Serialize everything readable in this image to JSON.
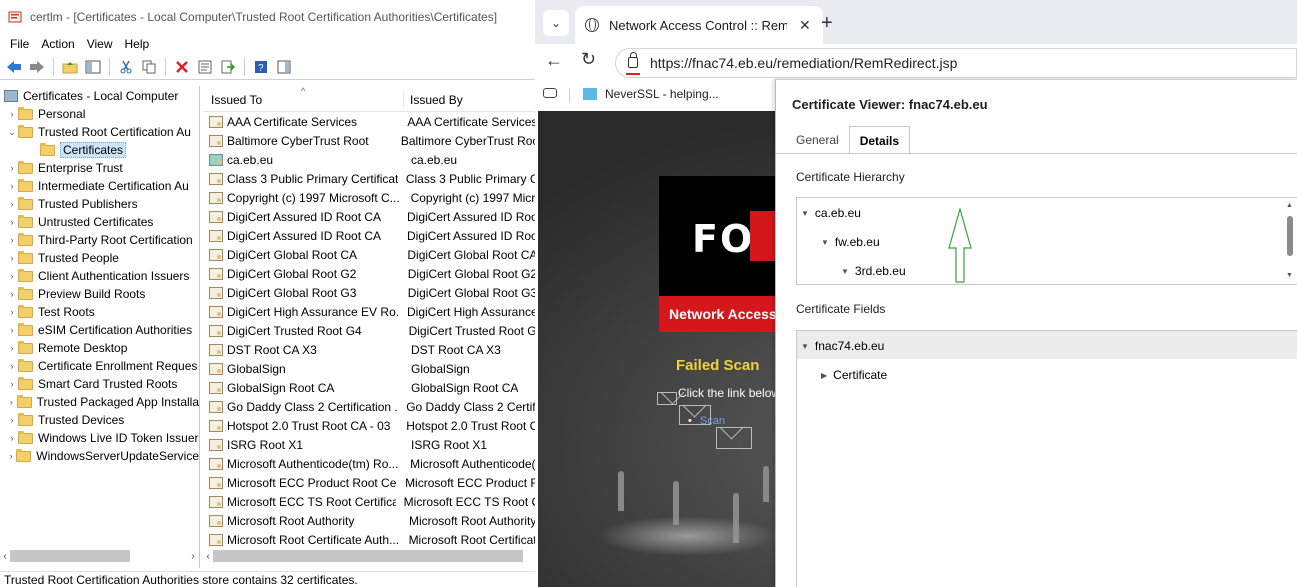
{
  "mmc": {
    "title": "certlm - [Certificates - Local Computer\\Trusted Root Certification Authorities\\Certificates]",
    "menu": [
      "File",
      "Action",
      "View",
      "Help"
    ],
    "tree": {
      "root": "Certificates - Local Computer",
      "items": [
        {
          "label": "Personal",
          "arrow": "›"
        },
        {
          "label": "Trusted Root Certification Au",
          "arrow": "⌄"
        },
        {
          "label": "Certificates",
          "arrow": ""
        },
        {
          "label": "Enterprise Trust",
          "arrow": "›"
        },
        {
          "label": "Intermediate Certification Au",
          "arrow": "›"
        },
        {
          "label": "Trusted Publishers",
          "arrow": "›"
        },
        {
          "label": "Untrusted Certificates",
          "arrow": "›"
        },
        {
          "label": "Third-Party Root Certification",
          "arrow": "›"
        },
        {
          "label": "Trusted People",
          "arrow": "›"
        },
        {
          "label": "Client Authentication Issuers",
          "arrow": "›"
        },
        {
          "label": "Preview Build Roots",
          "arrow": "›"
        },
        {
          "label": "Test Roots",
          "arrow": "›"
        },
        {
          "label": "eSIM Certification Authorities",
          "arrow": "›"
        },
        {
          "label": "Remote Desktop",
          "arrow": "›"
        },
        {
          "label": "Certificate Enrollment Reques",
          "arrow": "›"
        },
        {
          "label": "Smart Card Trusted Roots",
          "arrow": "›"
        },
        {
          "label": "Trusted Packaged App Installa",
          "arrow": "›"
        },
        {
          "label": "Trusted Devices",
          "arrow": "›"
        },
        {
          "label": "Windows Live ID Token Issuer",
          "arrow": "›"
        },
        {
          "label": "WindowsServerUpdateService",
          "arrow": "›"
        }
      ]
    },
    "list": {
      "col_issued_to": "Issued To",
      "col_issued_by": "Issued By",
      "rows": [
        [
          "AAA Certificate Services",
          "AAA Certificate Services"
        ],
        [
          "Baltimore CyberTrust Root",
          "Baltimore CyberTrust Root"
        ],
        [
          "ca.eb.eu",
          "ca.eb.eu"
        ],
        [
          "Class 3 Public Primary Certificat...",
          "Class 3 Public Primary C"
        ],
        [
          "Copyright (c) 1997 Microsoft C...",
          "Copyright (c) 1997 Micr"
        ],
        [
          "DigiCert Assured ID Root CA",
          "DigiCert Assured ID Roo"
        ],
        [
          "DigiCert Assured ID Root CA",
          "DigiCert Assured ID Roo"
        ],
        [
          "DigiCert Global Root CA",
          "DigiCert Global Root CA"
        ],
        [
          "DigiCert Global Root G2",
          "DigiCert Global Root G2"
        ],
        [
          "DigiCert Global Root G3",
          "DigiCert Global Root G3"
        ],
        [
          "DigiCert High Assurance EV Ro...",
          "DigiCert High Assurance"
        ],
        [
          "DigiCert Trusted Root G4",
          "DigiCert Trusted Root G"
        ],
        [
          "DST Root CA X3",
          "DST Root CA X3"
        ],
        [
          "GlobalSign",
          "GlobalSign"
        ],
        [
          "GlobalSign Root CA",
          "GlobalSign Root CA"
        ],
        [
          "Go Daddy Class 2 Certification ...",
          "Go Daddy Class 2 Certifi"
        ],
        [
          "Hotspot 2.0 Trust Root CA - 03",
          "Hotspot 2.0 Trust Root C"
        ],
        [
          "ISRG Root X1",
          "ISRG Root X1"
        ],
        [
          "Microsoft Authenticode(tm) Ro...",
          "Microsoft Authenticode("
        ],
        [
          "Microsoft ECC Product Root Ce...",
          "Microsoft ECC Product R"
        ],
        [
          "Microsoft ECC TS Root Certifica...",
          "Microsoft ECC TS Root C"
        ],
        [
          "Microsoft Root Authority",
          "Microsoft Root Authority"
        ],
        [
          "Microsoft Root Certificate Auth...",
          "Microsoft Root Certificat"
        ]
      ]
    },
    "status": "Trusted Root Certification Authorities store contains 32 certificates."
  },
  "browser": {
    "tab_title": "Network Access Control :: Remediation",
    "url": "https://fnac74.eb.eu/remediation/RemRedirect.jsp",
    "favorite": "NeverSSL - helping...",
    "page": {
      "logo": "FO",
      "banner": "Network Access",
      "failed": "Failed Scan",
      "click": "Click the link below",
      "scan_link": "Scan"
    }
  },
  "viewer": {
    "title": "Certificate Viewer: fnac74.eb.eu",
    "tabs": [
      "General",
      "Details"
    ],
    "hierarchy_label": "Certificate Hierarchy",
    "hierarchy": [
      "ca.eb.eu",
      "fw.eb.eu",
      "3rd.eb.eu"
    ],
    "fields_label": "Certificate Fields",
    "fields_root": "fnac74.eb.eu",
    "fields_child": "Certificate"
  },
  "colors": {
    "fortinet_red": "#d5161b",
    "failed_yellow": "#f0d23c",
    "annotation_green": "#3aa13a"
  }
}
